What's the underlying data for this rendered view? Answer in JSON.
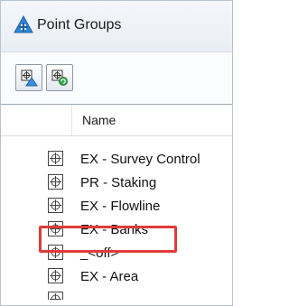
{
  "window": {
    "title": "Point Groups"
  },
  "toolbar": {
    "buttons": [
      {
        "icon": "point-group-properties-icon"
      },
      {
        "icon": "update-point-groups-icon"
      }
    ]
  },
  "list": {
    "column_header": "Name",
    "rows": [
      {
        "label": "EX - Survey Control",
        "icon": "point-group-icon"
      },
      {
        "label": "PR - Staking",
        "icon": "point-group-icon"
      },
      {
        "label": "EX - Flowline",
        "icon": "point-group-icon"
      },
      {
        "label": "EX - Banks",
        "icon": "point-group-icon"
      },
      {
        "label": "_<off>",
        "icon": "point-group-icon",
        "highlighted": true
      },
      {
        "label": "EX - Area",
        "icon": "point-group-icon"
      }
    ]
  },
  "colors": {
    "highlight_border": "#e03b3b",
    "accent": "#2a7fd4"
  }
}
